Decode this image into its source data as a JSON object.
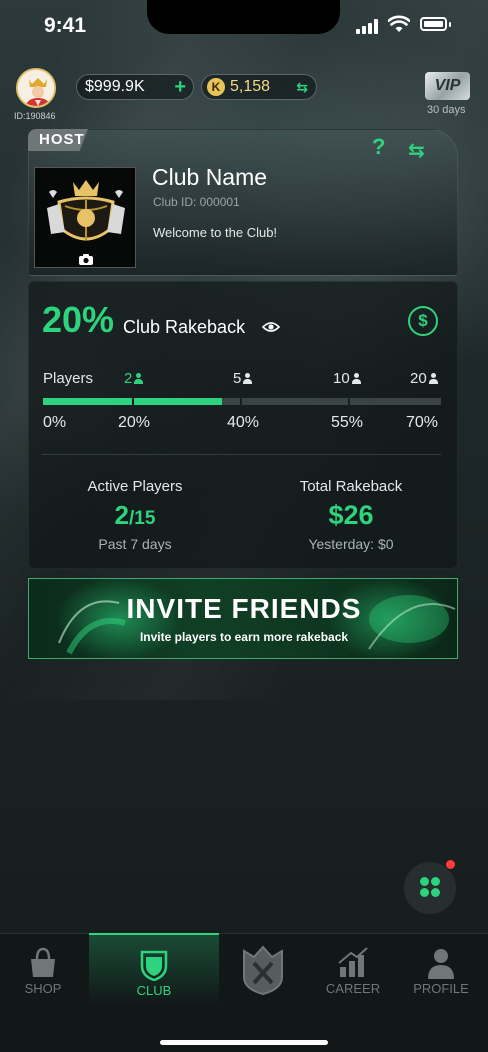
{
  "status": {
    "time": "9:41"
  },
  "user": {
    "id_label": "ID:190846",
    "balance": "$999.9K",
    "k_balance": "5,158",
    "k_symbol": "K"
  },
  "vip": {
    "label": "VIP",
    "days": "30 days"
  },
  "club": {
    "role": "HOST",
    "name": "Club Name",
    "id_label": "Club ID: 000001",
    "welcome": "Welcome to the Club!"
  },
  "rakeback": {
    "percent": "20%",
    "title": "Club Rakeback",
    "players_label": "Players",
    "tiers": [
      {
        "players": "2",
        "pct": "20%",
        "active": true
      },
      {
        "players": "5",
        "pct": "40%",
        "active": false
      },
      {
        "players": "10",
        "pct": "55%",
        "active": false
      },
      {
        "players": "20",
        "pct": "70%",
        "active": false
      }
    ],
    "base_pct": "0%",
    "progress_fraction": 0.45
  },
  "stats": {
    "active_label": "Active Players",
    "active_count": "2",
    "active_total": "/15",
    "active_sub": "Past 7 days",
    "total_label": "Total Rakeback",
    "total_value": "$26",
    "total_sub": "Yesterday: $0"
  },
  "invite": {
    "title": "INVITE FRIENDS",
    "subtitle": "Invite players to earn more rakeback"
  },
  "tabs": [
    {
      "label": "SHOP",
      "icon": "shop-bag-icon"
    },
    {
      "label": "CLUB",
      "icon": "club-shield-icon",
      "active": true
    },
    {
      "label": "",
      "icon": "emblem-logo-icon"
    },
    {
      "label": "CAREER",
      "icon": "career-chart-icon"
    },
    {
      "label": "PROFILE",
      "icon": "profile-person-icon"
    }
  ],
  "colors": {
    "accent": "#2dd37d",
    "notification": "#ff3b3b"
  }
}
